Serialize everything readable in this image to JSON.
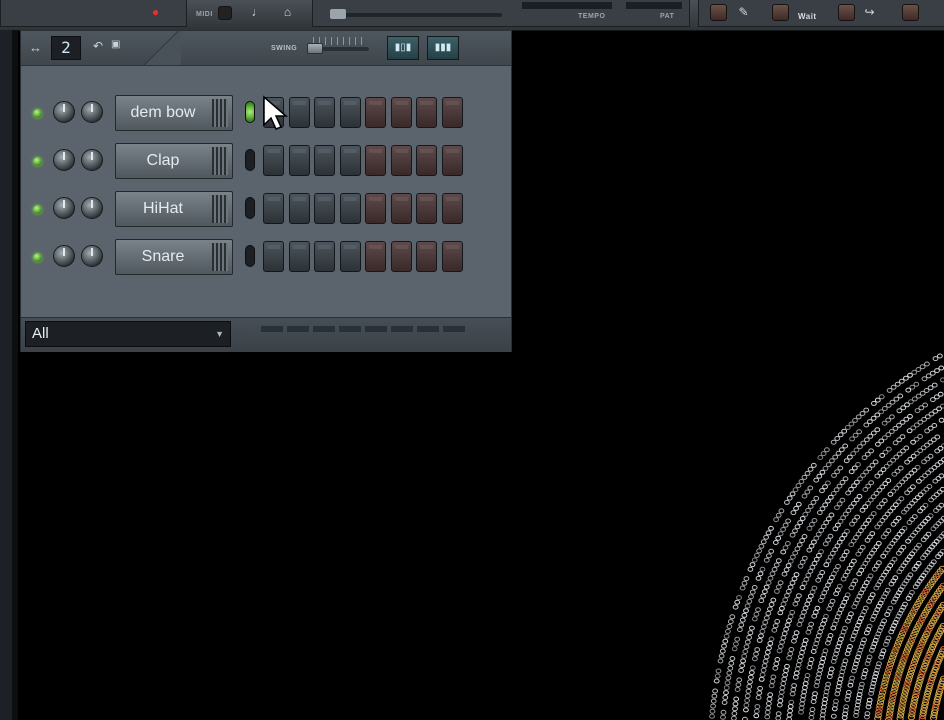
{
  "toolbar": {
    "midi_label": "MIDI",
    "tempo_label": "TEMPO",
    "pat_label": "PAT",
    "wait_label": "Wait"
  },
  "sequencer": {
    "pattern_number": "2",
    "swing_label": "SWING",
    "filter_value": "All",
    "steps_per_row": 8,
    "channels": [
      {
        "name": "dem bow",
        "selected": true
      },
      {
        "name": "Clap",
        "selected": false
      },
      {
        "name": "HiHat",
        "selected": false
      },
      {
        "name": "Snare",
        "selected": false
      }
    ]
  },
  "colors": {
    "panel": "#5b646c",
    "step_dark_group": "#2c3237",
    "step_red_group": "#3a2929",
    "led_green": "#6cd23a",
    "visualizer_white": "#e8ecf0",
    "visualizer_gold": "#e0b34a",
    "visualizer_red": "#e86a3a"
  }
}
